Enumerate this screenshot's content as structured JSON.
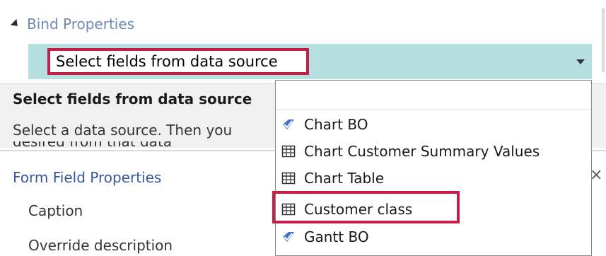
{
  "bind_properties": {
    "header": "Bind Properties",
    "select_value": "Select fields from data source"
  },
  "help": {
    "title": "Select fields from data source",
    "text": "Select a data source. Then you",
    "text_cut": "desired from that data"
  },
  "form_field_properties": {
    "title": "Form Field Properties",
    "caption_label": "Caption",
    "override_label": "Override description"
  },
  "dropdown": {
    "items": [
      {
        "label": "Chart BO",
        "icon": "business-object-icon"
      },
      {
        "label": "Chart Customer Summary Values",
        "icon": "table-icon"
      },
      {
        "label": "Chart Table",
        "icon": "table-icon"
      },
      {
        "label": "Customer class",
        "icon": "table-icon"
      },
      {
        "label": "Gantt BO",
        "icon": "business-object-icon"
      }
    ]
  },
  "colors": {
    "highlight": "#c41f46",
    "select_fill": "#b6e0e0",
    "section_header": "#6f89b3",
    "link_blue": "#34579f"
  }
}
